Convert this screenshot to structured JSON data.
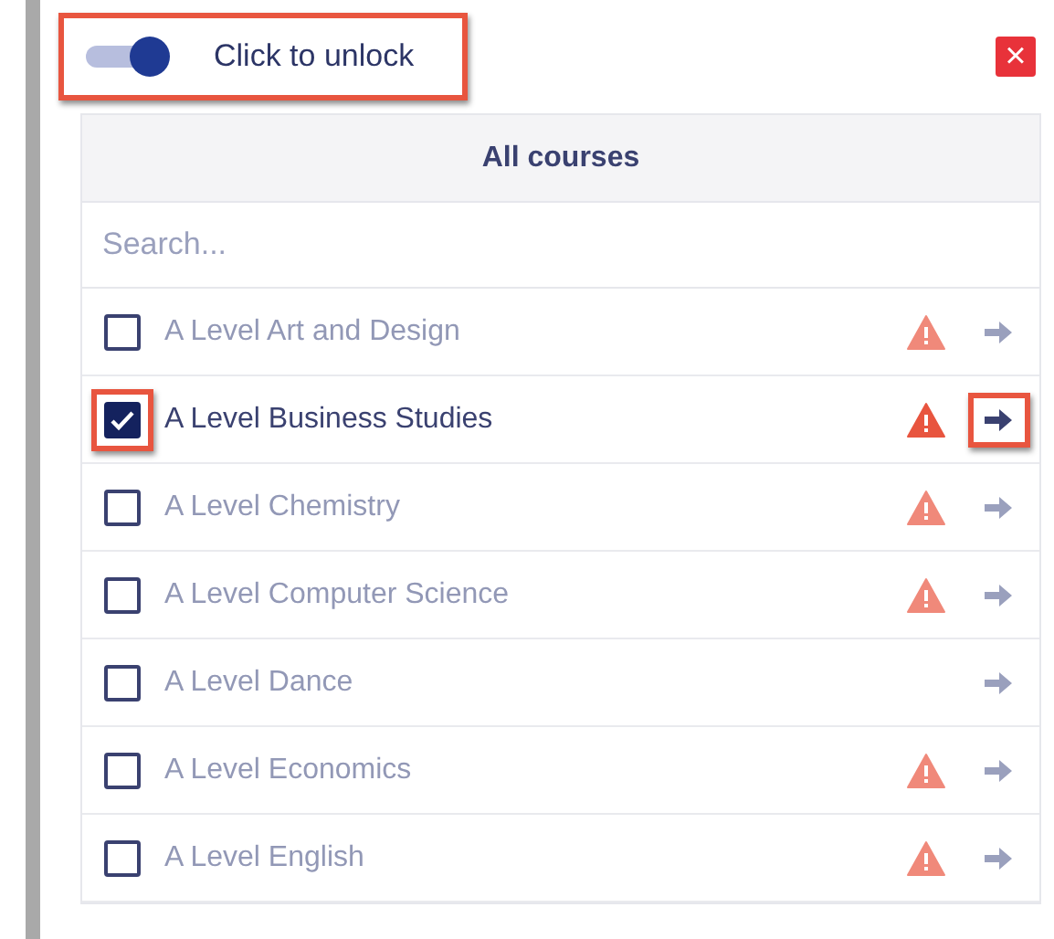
{
  "toggle": {
    "label": "Click to unlock",
    "on": true,
    "highlighted": true
  },
  "close_button": {
    "label": "×"
  },
  "list_header": "All courses",
  "search": {
    "placeholder": "Search..."
  },
  "courses": [
    {
      "name": "A Level Art and Design",
      "checked": false,
      "warning": true,
      "checkbox_highlighted": false,
      "arrow_highlighted": false
    },
    {
      "name": "A Level Business Studies",
      "checked": true,
      "warning": true,
      "checkbox_highlighted": true,
      "arrow_highlighted": true
    },
    {
      "name": "A Level Chemistry",
      "checked": false,
      "warning": true,
      "checkbox_highlighted": false,
      "arrow_highlighted": false
    },
    {
      "name": "A Level Computer Science",
      "checked": false,
      "warning": true,
      "checkbox_highlighted": false,
      "arrow_highlighted": false
    },
    {
      "name": "A Level Dance",
      "checked": false,
      "warning": false,
      "checkbox_highlighted": false,
      "arrow_highlighted": false
    },
    {
      "name": "A Level Economics",
      "checked": false,
      "warning": true,
      "checkbox_highlighted": false,
      "arrow_highlighted": false
    },
    {
      "name": "A Level English",
      "checked": false,
      "warning": true,
      "checkbox_highlighted": false,
      "arrow_highlighted": false
    }
  ]
}
